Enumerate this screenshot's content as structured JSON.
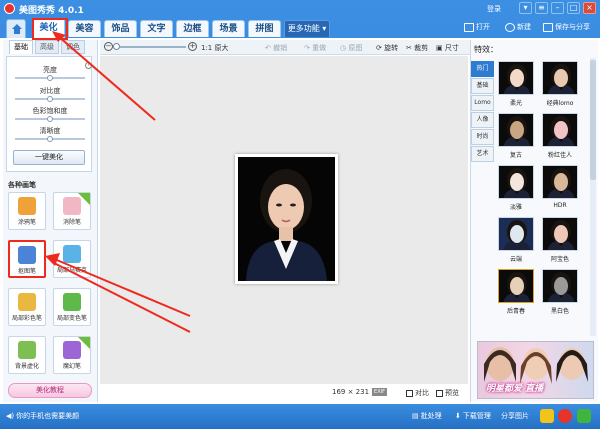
{
  "window": {
    "title": "美图秀秀 4.0.1",
    "login": "登录"
  },
  "nav": {
    "tabs": [
      "美化",
      "美容",
      "饰品",
      "文字",
      "边框",
      "场景",
      "拼图"
    ],
    "more": "更多功能 ▾",
    "actions": {
      "open": "打开",
      "new": "新建",
      "save": "保存与分享"
    }
  },
  "left": {
    "subtabs": [
      "基础",
      "高级",
      "调色"
    ],
    "sliders": [
      {
        "label": "亮度",
        "value": 0.5
      },
      {
        "label": "对比度",
        "value": 0.5
      },
      {
        "label": "色彩饱和度",
        "value": 0.5
      },
      {
        "label": "清晰度",
        "value": 0.5
      }
    ],
    "onekey": "一键美化",
    "pens_title": "各种画笔",
    "pens": [
      {
        "label": "涂鸦笔",
        "color": "#f0a23a"
      },
      {
        "label": "消除笔",
        "color": "#f2b7c5"
      },
      {
        "label": "抠图笔",
        "color": "#4b83d6"
      },
      {
        "label": "局部马赛克",
        "color": "#5ab3e6"
      },
      {
        "label": "局部彩色笔",
        "color": "#e8b840"
      },
      {
        "label": "局部变色笔",
        "color": "#5fb84a"
      },
      {
        "label": "背景虚化",
        "color": "#7dbf52"
      },
      {
        "label": "魔幻笔",
        "color": "#9d65d6"
      }
    ],
    "tutorial": "美化教程"
  },
  "toolbar": {
    "zoom_out": "-",
    "zoom_in": "+",
    "actual": "1:1 原大",
    "undo": "撤销",
    "redo": "重做",
    "reset": "原图",
    "rotate": "旋转",
    "crop": "裁剪",
    "resize": "尺寸"
  },
  "canvas": {
    "size_readout": "169 × 231",
    "exif": "EXIF",
    "compare": "对比",
    "preview": "预览"
  },
  "effects": {
    "title": "特效：",
    "tabs": [
      "热门",
      "基础",
      "Lomo",
      "人像",
      "时尚",
      "艺术"
    ],
    "items": [
      "柔光",
      "经典lomo",
      "复古",
      "粉红佳人",
      "淡雅",
      "HDR",
      "云端",
      "阿宝色",
      "后青春",
      "黑白色"
    ],
    "banner": "明星都爱 直播"
  },
  "status": {
    "phone": "你的手机也需要美颜",
    "batch": "批处理",
    "download": "下载管理",
    "share": "分享图片"
  },
  "colors": {
    "accent": "#2e7bd0",
    "highlight": "#ee2a1f"
  }
}
